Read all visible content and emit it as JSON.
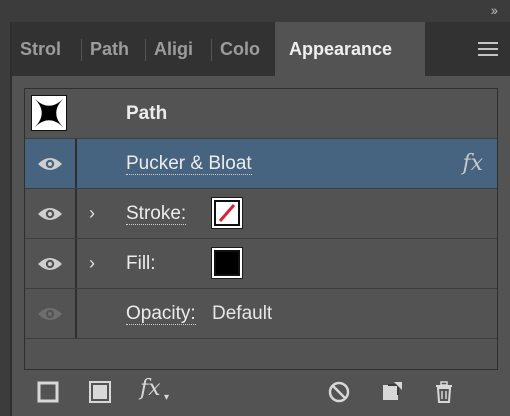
{
  "window": {
    "collapse_glyph": "››"
  },
  "tabs": [
    {
      "label": "Strol",
      "active": false
    },
    {
      "label": "Path",
      "active": false
    },
    {
      "label": "Aligi",
      "active": false
    },
    {
      "label": "Colo",
      "active": false
    },
    {
      "label": "Appearance",
      "active": true
    }
  ],
  "panel_menu_icon": "hamburger-menu-icon",
  "appearance": {
    "header": {
      "label": "Path",
      "thumbnail_icon": "pucker-star-thumbnail"
    },
    "rows": [
      {
        "label": "Pucker & Bloat",
        "selected": true,
        "visible": true,
        "effect_glyph": "fx"
      },
      {
        "label": "Stroke:",
        "visible": true,
        "expandable": true,
        "swatch": "none-red-slash"
      },
      {
        "label": "Fill:",
        "visible": true,
        "expandable": true,
        "swatch": "black"
      },
      {
        "label": "Opacity:",
        "value": "Default",
        "visible": true,
        "dimmed_eye": true
      }
    ]
  },
  "toolbar": {
    "fx_glyph": "fx",
    "icons": [
      "add-new-stroke-icon",
      "add-new-fill-icon",
      "add-new-effect-icon",
      "clear-appearance-icon",
      "duplicate-item-icon",
      "delete-item-icon"
    ]
  },
  "colors": {
    "panel_bg": "#535353",
    "tabbar_bg": "#323232",
    "selected_row": "#46637f",
    "stroke_slash": "#d6213a"
  }
}
